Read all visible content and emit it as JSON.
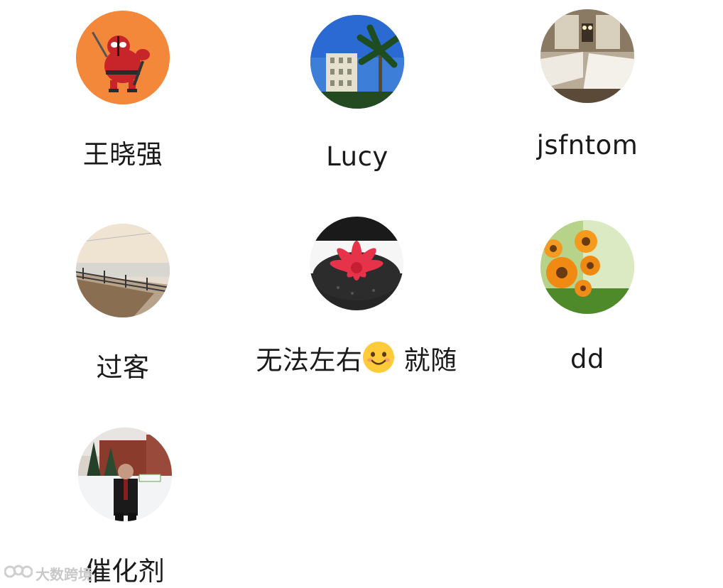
{
  "contacts": [
    {
      "name": "王晓强",
      "avatar_icon": "deadpool-cartoon-avatar-icon"
    },
    {
      "name": "Lucy",
      "avatar_icon": "palm-building-sky-avatar-icon"
    },
    {
      "name": "jsfntom",
      "avatar_icon": "hotel-room-avatar-icon"
    },
    {
      "name": "过客",
      "avatar_icon": "railway-bridge-avatar-icon"
    },
    {
      "name_before_emoji": "无法左右",
      "emoji_icon": "smiling-face-emoji-icon",
      "name_after_emoji": "就随",
      "avatar_icon": "red-succulent-avatar-icon"
    },
    {
      "name": "dd",
      "avatar_icon": "sunflowers-avatar-icon"
    },
    {
      "name": "催化剂",
      "avatar_icon": "man-in-snow-avatar-icon"
    }
  ],
  "watermark": {
    "text": "大数跨境",
    "logo_icon": "dashu-logo-icon"
  },
  "colors": {
    "background": "#ffffff",
    "name_text": "#1a1a1a",
    "watermark": "#c8c8c8"
  }
}
